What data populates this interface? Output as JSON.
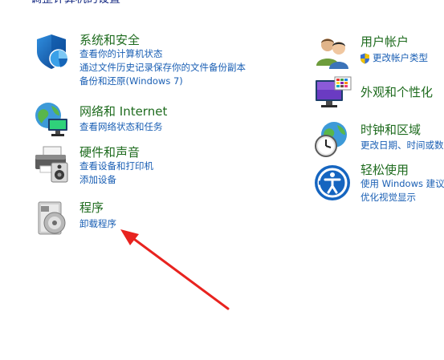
{
  "header": {
    "title": "调整计算机的设置"
  },
  "left_column": [
    {
      "key": "system",
      "title": "系统和安全",
      "icon": "security-shield-icon",
      "links": [
        "查看你的计算机状态",
        "通过文件历史记录保存你的文件备份副本",
        "备份和还原(Windows 7)"
      ]
    },
    {
      "key": "network",
      "title": "网络和 Internet",
      "icon": "network-globe-icon",
      "links": [
        "查看网络状态和任务"
      ]
    },
    {
      "key": "hardware",
      "title": "硬件和声音",
      "icon": "printer-speaker-icon",
      "links": [
        "查看设备和打印机",
        "添加设备"
      ]
    },
    {
      "key": "programs",
      "title": "程序",
      "icon": "programs-disc-icon",
      "links": [
        "卸载程序"
      ]
    }
  ],
  "right_column": [
    {
      "key": "accounts",
      "title": "用户帐户",
      "icon": "users-icon",
      "links": [
        "更改帐户类型"
      ]
    },
    {
      "key": "appearance",
      "title": "外观和个性化",
      "icon": "monitor-palette-icon",
      "links": []
    },
    {
      "key": "clock",
      "title": "时钟和区域",
      "icon": "clock-globe-icon",
      "links": [
        "更改日期、时间或数"
      ]
    },
    {
      "key": "ease",
      "title": "轻松使用",
      "icon": "ease-of-access-icon",
      "links": [
        "使用 Windows 建议",
        "优化视觉显示"
      ]
    }
  ],
  "colors": {
    "category_title": "#1e6b1e",
    "link": "#1a5fb4",
    "header": "#1e3287",
    "arrow": "#e8231f"
  }
}
